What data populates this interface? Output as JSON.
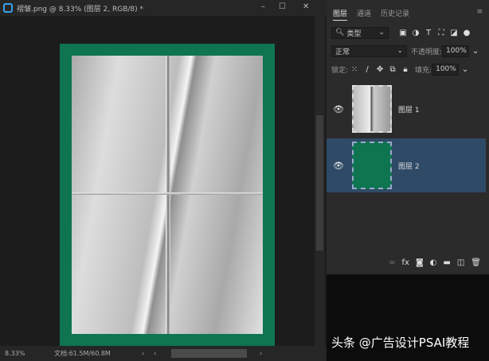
{
  "window": {
    "title": "褶皱.png @ 8.33% (图层 2, RGB/8) *",
    "minimize": "–",
    "maximize": "☐",
    "close": "✕"
  },
  "status": {
    "zoom": "8.33%",
    "doc": "文档:61.5M/60.8M",
    "arrow_right": "›",
    "arrow_left": "‹",
    "arrow_right2": "›"
  },
  "panel": {
    "tabs": [
      {
        "label": "图层"
      },
      {
        "label": "通道"
      },
      {
        "label": "历史记录"
      }
    ],
    "filter": {
      "label": "类型",
      "icons": [
        "image-filter-icon",
        "adjustment-filter-icon",
        "type-filter-icon",
        "shape-filter-icon",
        "smart-object-filter-icon"
      ]
    },
    "blend_mode": "正常",
    "opacity_label": "不透明度:",
    "opacity": "100%",
    "lock_label": "锁定:",
    "fill_label": "填充:",
    "fill": "100%",
    "layers": [
      {
        "name": "图层 1",
        "visible": true,
        "selected": false,
        "thumb_color": "#c8c8c8"
      },
      {
        "name": "图层 2",
        "visible": true,
        "selected": true,
        "thumb_color": "#0f7450"
      }
    ],
    "selected_color": "#2f4a66"
  },
  "colors": {
    "doc_green": "#0f7450"
  },
  "watermark": "头条 @广告设计PSAI教程"
}
